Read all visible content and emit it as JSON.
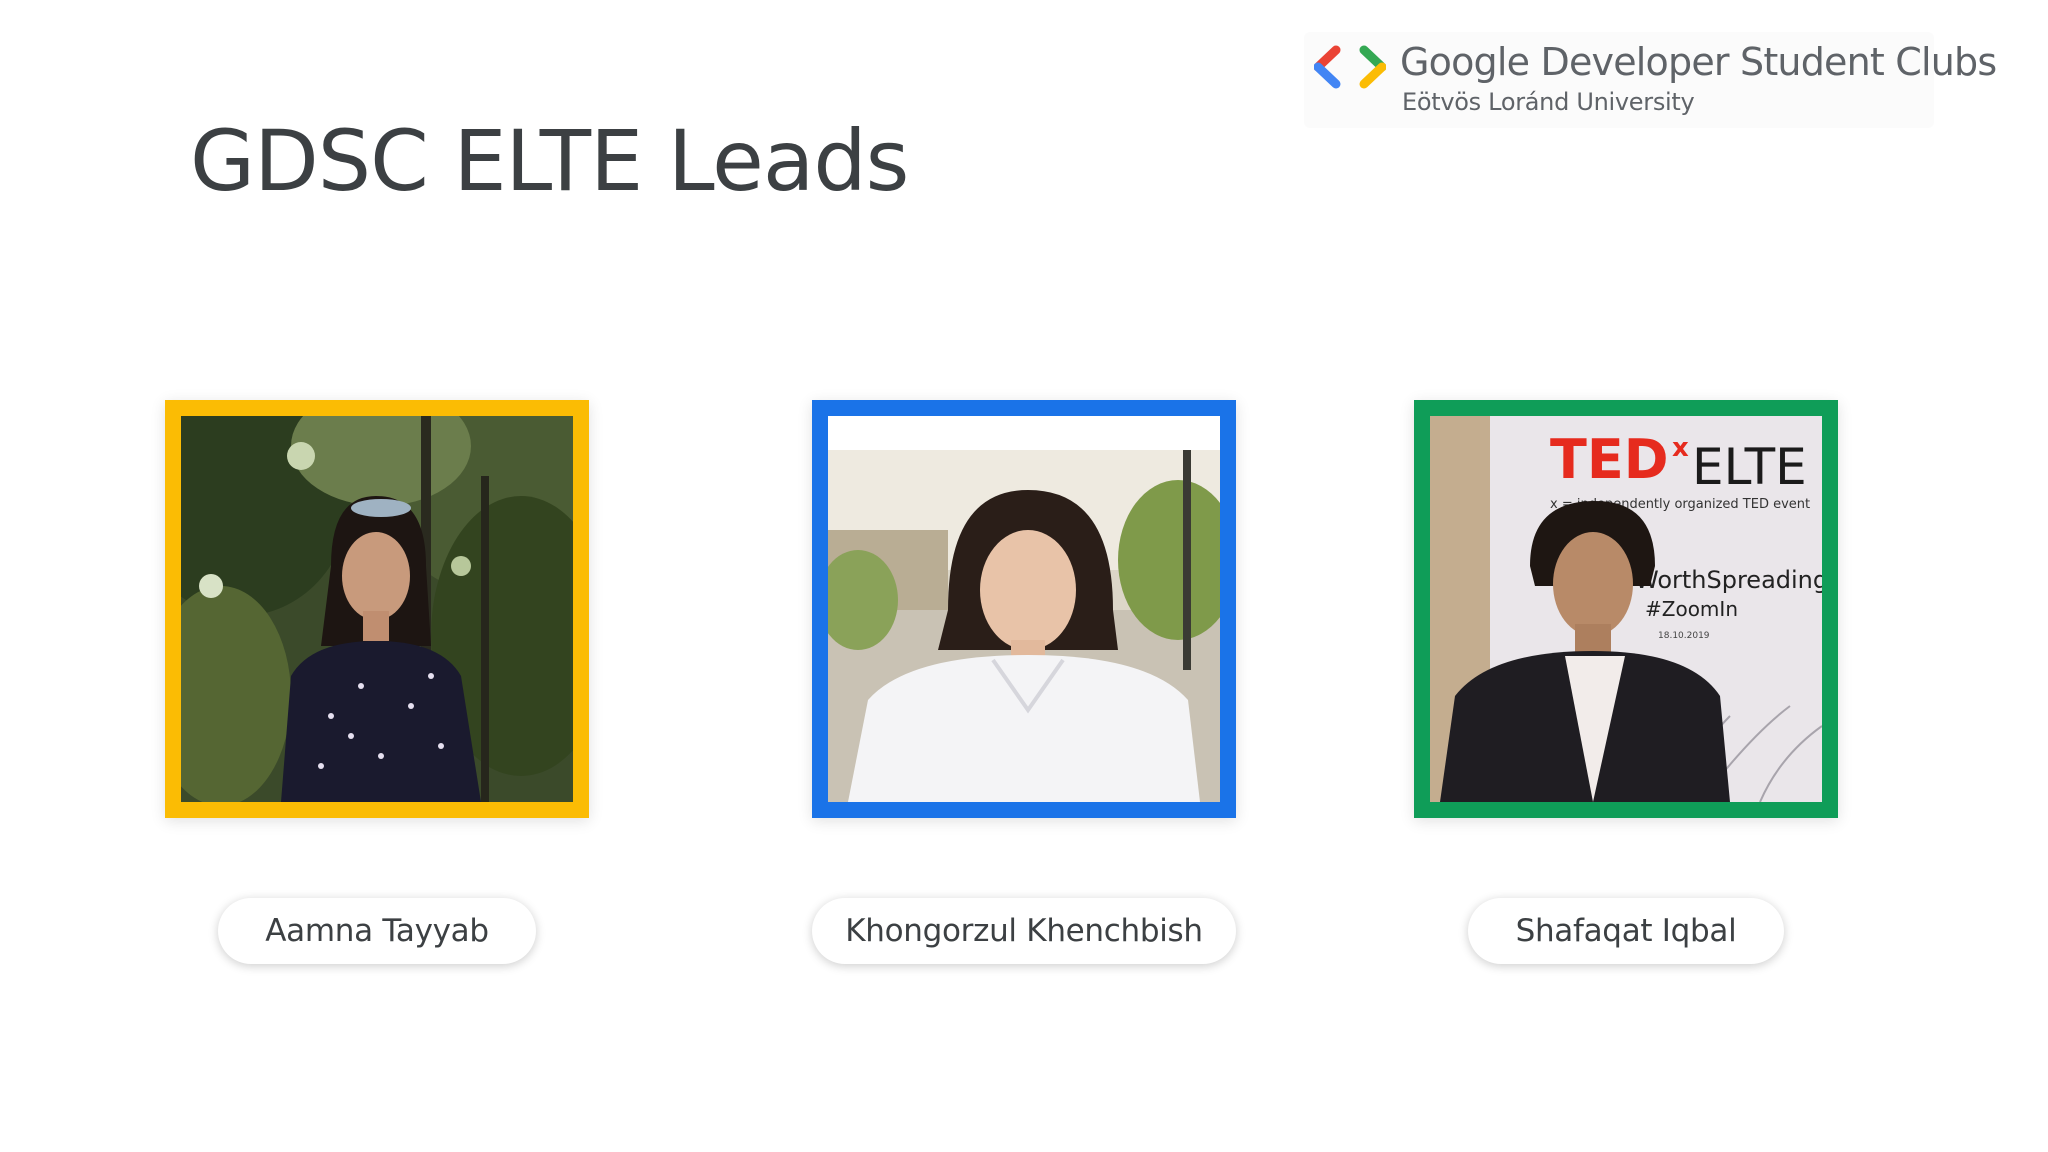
{
  "logo": {
    "title": "Google Developer Student Clubs",
    "subtitle": "Eötvös Loránd University",
    "icon": "gdsc-brackets-icon",
    "colors": [
      "#ea4335",
      "#4285f4",
      "#34a853",
      "#fbbc04"
    ]
  },
  "slide": {
    "title": "GDSC ELTE Leads"
  },
  "leads": [
    {
      "name": "Aamna Tayyab",
      "frame_color": "#fbbc04"
    },
    {
      "name": "Khongorzul Khenchbish",
      "frame_color": "#1a73e8"
    },
    {
      "name": "Shafaqat Iqbal",
      "frame_color": "#0f9d58"
    }
  ],
  "backdrop": {
    "brand": "TED",
    "brand_x": "x",
    "brand_rest": "ELTE",
    "tagline": "x = independently organized TED event",
    "hashtag1": "WorthSpreading",
    "hashtag2": "#ZoomIn",
    "date": "18.10.2019"
  }
}
